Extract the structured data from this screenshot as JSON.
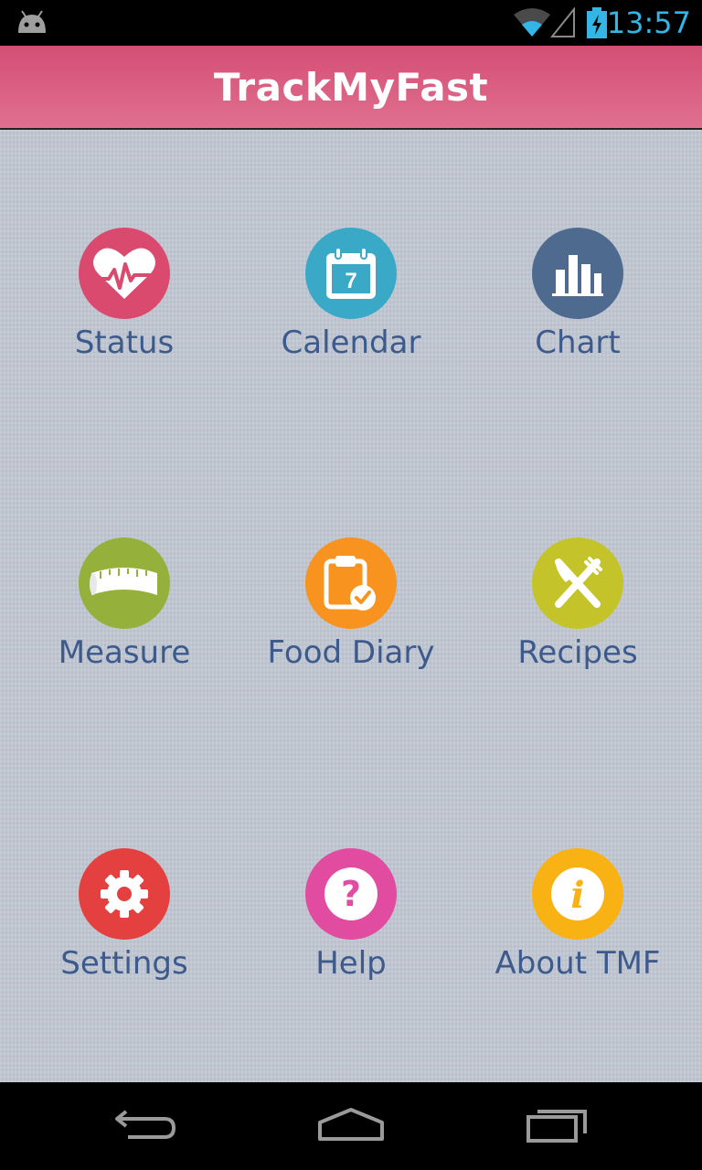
{
  "status_bar": {
    "time": "13:57"
  },
  "app_bar": {
    "title": "TrackMyFast"
  },
  "menu": [
    {
      "label": "Status",
      "icon": "heart-pulse-icon",
      "color": "#d94a6e"
    },
    {
      "label": "Calendar",
      "icon": "calendar-icon",
      "color": "#3aa8c7"
    },
    {
      "label": "Chart",
      "icon": "bar-chart-icon",
      "color": "#4e6a8f"
    },
    {
      "label": "Measure",
      "icon": "tape-measure-icon",
      "color": "#95b13b"
    },
    {
      "label": "Food Diary",
      "icon": "clipboard-check-icon",
      "color": "#f7931e"
    },
    {
      "label": "Recipes",
      "icon": "fork-knife-icon",
      "color": "#c4c42a"
    },
    {
      "label": "Settings",
      "icon": "gear-icon",
      "color": "#e4403f"
    },
    {
      "label": "Help",
      "icon": "question-icon",
      "color": "#e14ca1"
    },
    {
      "label": "About TMF",
      "icon": "info-icon",
      "color": "#f9b214"
    }
  ],
  "calendar_day": "7"
}
